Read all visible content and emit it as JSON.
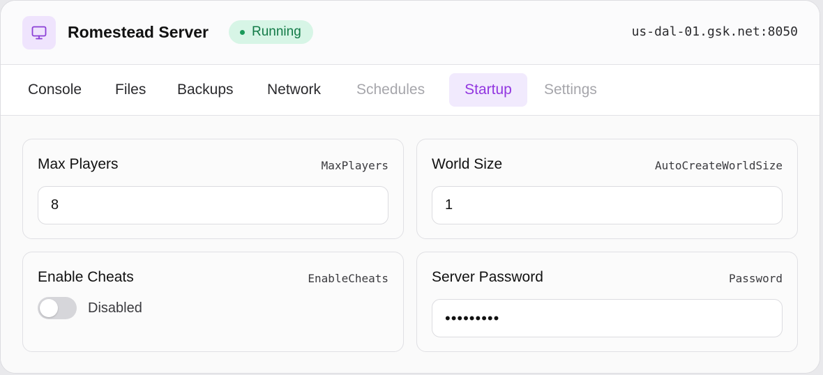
{
  "header": {
    "title": "Romestead Server",
    "icon": "monitor-icon",
    "status": "Running",
    "status_color": "#1a9a5a",
    "address": "us-dal-01.gsk.net:8050"
  },
  "tabs": [
    {
      "label": "Console",
      "state": "enabled"
    },
    {
      "label": "Files",
      "state": "enabled"
    },
    {
      "label": "Backups",
      "state": "enabled"
    },
    {
      "label": "Network",
      "state": "enabled"
    },
    {
      "label": "Schedules",
      "state": "disabled"
    },
    {
      "label": "Startup",
      "state": "active"
    },
    {
      "label": "Settings",
      "state": "disabled"
    }
  ],
  "accent_color": "#9236e0",
  "settings": {
    "max_players": {
      "title": "Max Players",
      "key": "MaxPlayers",
      "value": "8"
    },
    "world_size": {
      "title": "World Size",
      "key": "AutoCreateWorldSize",
      "value": "1"
    },
    "enable_cheats": {
      "title": "Enable Cheats",
      "key": "EnableCheats",
      "toggle_label": "Disabled",
      "enabled": false
    },
    "server_password": {
      "title": "Server Password",
      "key": "Password",
      "value": "•••••••••"
    }
  }
}
